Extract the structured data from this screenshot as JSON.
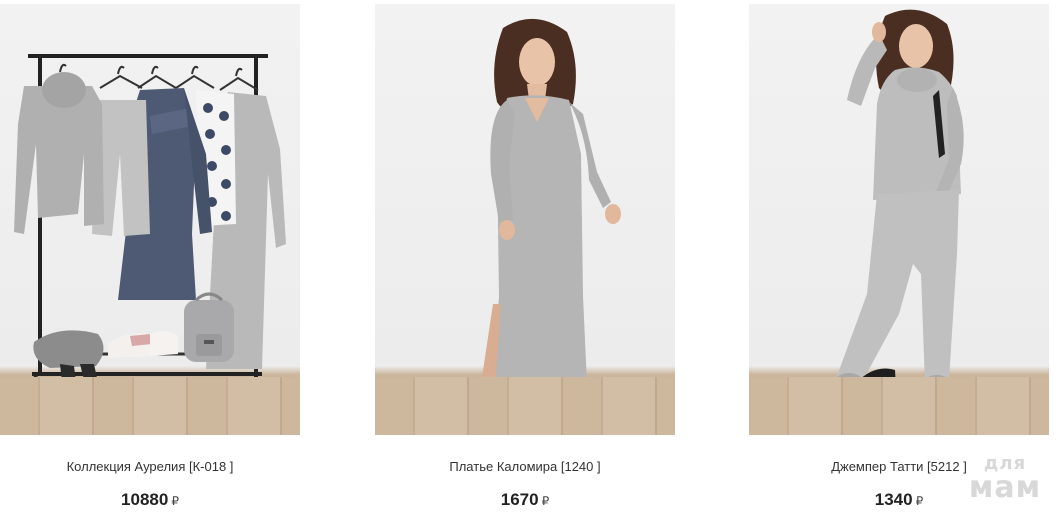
{
  "products": [
    {
      "name": "Коллекция Аурелия [К-018 ]",
      "price": "10880",
      "currency": "₽",
      "image": "clothing-rack-photo"
    },
    {
      "name": "Платье Каломира [1240 ]",
      "price": "1670",
      "currency": "₽",
      "image": "gray-dress-model-photo"
    },
    {
      "name": "Джемпер Татти [5212 ]",
      "price": "1340",
      "currency": "₽",
      "image": "gray-jumper-model-photo"
    }
  ],
  "watermark": {
    "line1": "для",
    "line2": "мам"
  },
  "colors": {
    "heather_gray": "#b8b8b8",
    "navy": "#4a5670",
    "floor": "#cbb59b"
  }
}
